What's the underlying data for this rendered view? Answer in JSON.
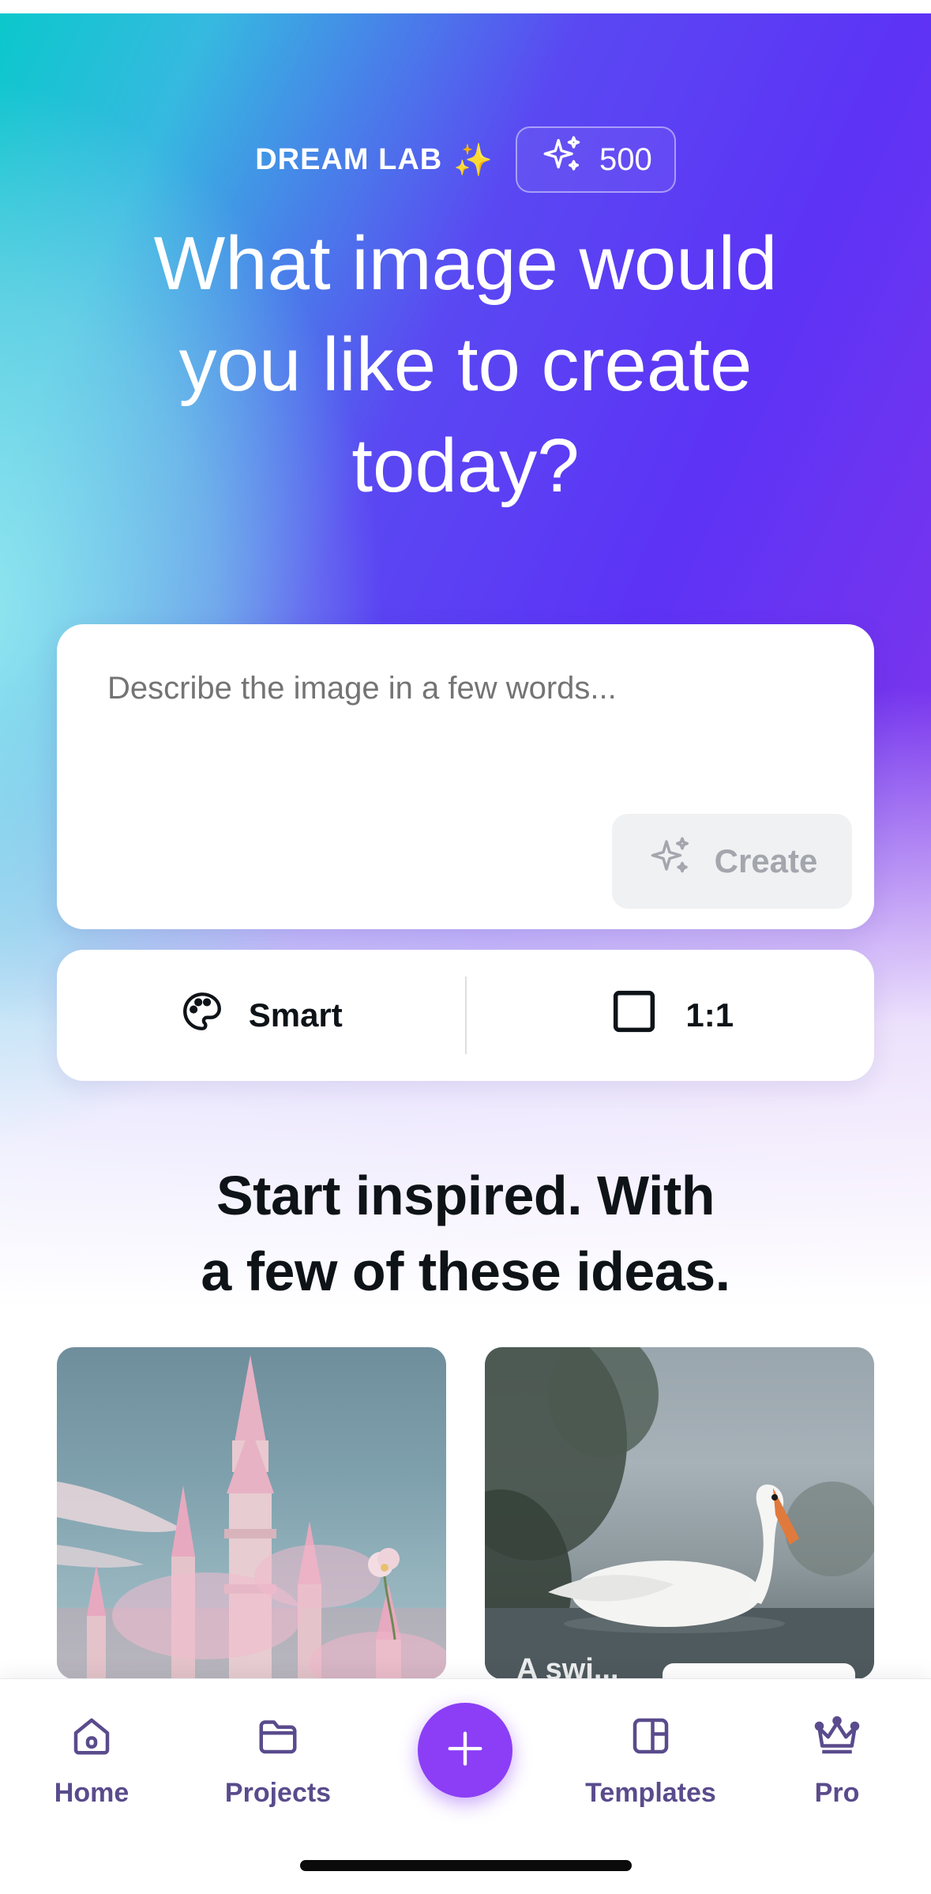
{
  "header": {
    "brand": "DREAM LAB",
    "brand_emoji": "✨",
    "credits": "500"
  },
  "hero": {
    "headline_lines": [
      "What image would",
      "you like to create",
      "today?"
    ]
  },
  "prompt": {
    "placeholder": "Describe the image in a few words...",
    "create_label": "Create"
  },
  "options": {
    "style_label": "Smart",
    "ratio_label": "1:1"
  },
  "inspiration": {
    "title_lines": [
      "Start inspired. With",
      "a few of these ideas."
    ],
    "tiles": [
      {
        "name": "pink-castle"
      },
      {
        "name": "swan",
        "label_partial": "A swi..."
      }
    ]
  },
  "nav": {
    "items": [
      {
        "label": "Home",
        "icon": "home-icon"
      },
      {
        "label": "Projects",
        "icon": "folder-icon"
      },
      {
        "label": "Templates",
        "icon": "templates-icon"
      },
      {
        "label": "Pro",
        "icon": "crown-icon"
      }
    ],
    "fab_icon": "plus-icon"
  },
  "colors": {
    "accent": "#8b3ef5",
    "nav_text": "#5a4b8c",
    "headline": "#ffffff",
    "dark_text": "#0e1318"
  }
}
